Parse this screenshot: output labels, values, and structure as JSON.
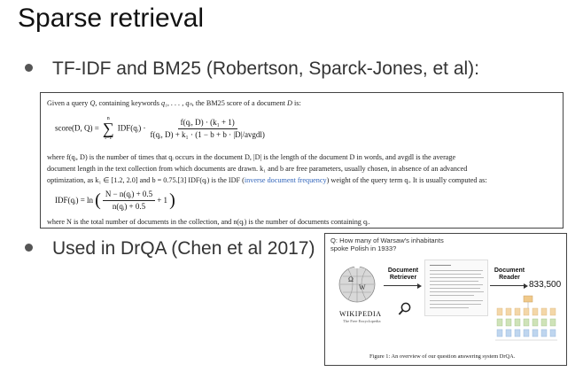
{
  "slide": {
    "title": "Sparse retrieval",
    "bullets": [
      "TF-IDF and BM25 (Robertson, Sparck-Jones, et al):",
      "Used in DrQA (Chen et al 2017)"
    ]
  },
  "bm25": {
    "intro_prefix": "Given a query ",
    "intro_q": "Q",
    "intro_mid": ", containing keywords ",
    "intro_keywords": "q₁, . . . , qₙ",
    "intro_suffix": ", the BM25 score of a document ",
    "intro_d": "D",
    "intro_end": " is:",
    "score_lhs": "score(D, Q) =",
    "sum_top": "n",
    "sum_sym": "∑",
    "sum_bottom": "i=1",
    "idf_term": "IDF(qᵢ) ·",
    "score_num": "f(qᵢ, D) · (k₁ + 1)",
    "score_den": "f(qᵢ, D) + k₁ · (1 − b + b · |D|/avgdl)",
    "where1": "where f(qᵢ, D) is the number of times that qᵢ occurs in the document D, |D| is the length of the document D in words, and avgdl is the average",
    "where2": "document length in the text collection from which documents are drawn. k₁ and b are free parameters, usually chosen, in absence of an advanced",
    "where3_a": "optimization, as k₁ ∈ [1.2, 2.0] and b = 0.75.[3] IDF(qᵢ) is the IDF (",
    "where3_link": "inverse document frequency",
    "where3_b": ") weight of the query term qᵢ. It is usually computed as:",
    "idf_lhs": "IDF(qᵢ) = ln",
    "idf_num": "N − n(qᵢ) + 0.5",
    "idf_den": "n(qᵢ) + 0.5",
    "idf_tail": "+ 1",
    "final": "where N is the total number of documents in the collection, and n(qᵢ) is the number of documents containing qᵢ."
  },
  "drqa": {
    "question": "Q:  How many of Warsaw's inhabitants spoke Polish in 1933?",
    "wiki_title": "WIKIPEDIA",
    "wiki_sub": "The Free Encyclopedia",
    "retriever_label": "Document Retriever",
    "reader_label": "Document Reader",
    "answer": "833,500",
    "caption": "Figure 1:  An overview of our question answering system DrQA."
  },
  "icons": [
    "wikipedia-globe-icon",
    "magnifier-icon",
    "reader-network-icon"
  ],
  "colors": {
    "link": "#3366bb",
    "text": "#222222"
  }
}
